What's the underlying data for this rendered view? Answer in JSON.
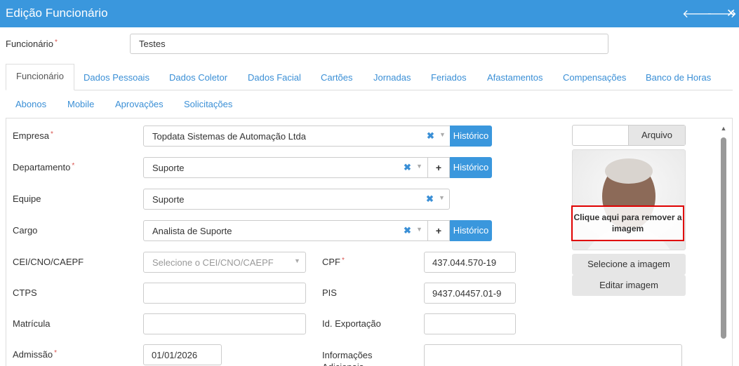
{
  "window": {
    "title": "Edição Funcionário"
  },
  "employee": {
    "label": "Funcionário",
    "value": "Testes"
  },
  "tabs_row1": [
    "Funcionário",
    "Dados Pessoais",
    "Dados Coletor",
    "Dados Facial",
    "Cartões",
    "Jornadas",
    "Feriados",
    "Afastamentos",
    "Compensações",
    "Banco de Horas"
  ],
  "tabs_row2": [
    "Abonos",
    "Mobile",
    "Aprovações",
    "Solicitações"
  ],
  "form": {
    "empresa": {
      "label": "Empresa",
      "value": "Topdata Sistemas de Automação Ltda"
    },
    "departamento": {
      "label": "Departamento",
      "value": "Suporte"
    },
    "equipe": {
      "label": "Equipe",
      "value": "Suporte"
    },
    "cargo": {
      "label": "Cargo",
      "value": "Analista de Suporte"
    },
    "cei": {
      "label": "CEI/CNO/CAEPF",
      "placeholder": "Selecione o CEI/CNO/CAEPF"
    },
    "cpf": {
      "label": "CPF",
      "value": "437.044.570-19"
    },
    "ctps": {
      "label": "CTPS",
      "value": ""
    },
    "pis": {
      "label": "PIS",
      "value": "9437.04457.01-9"
    },
    "matricula": {
      "label": "Matrícula",
      "value": ""
    },
    "id_exportacao": {
      "label": "Id. Exportação",
      "value": ""
    },
    "admissao": {
      "label": "Admissão",
      "value": "01/01/2026"
    },
    "informacoes": {
      "label": "Informações Adicionais"
    },
    "historico_label": "Histórico",
    "required_mark": "*",
    "plus_label": "+",
    "clear_mark": "✖"
  },
  "photo": {
    "arquivo_label": "Arquivo",
    "remove_label": "Clique aqui para remover a imagem",
    "select_label": "Selecione a imagem",
    "edit_label": "Editar imagem"
  },
  "colors": {
    "header": "#3a97dd",
    "accent": "#3a8fd6",
    "highlight": "#e00000"
  }
}
